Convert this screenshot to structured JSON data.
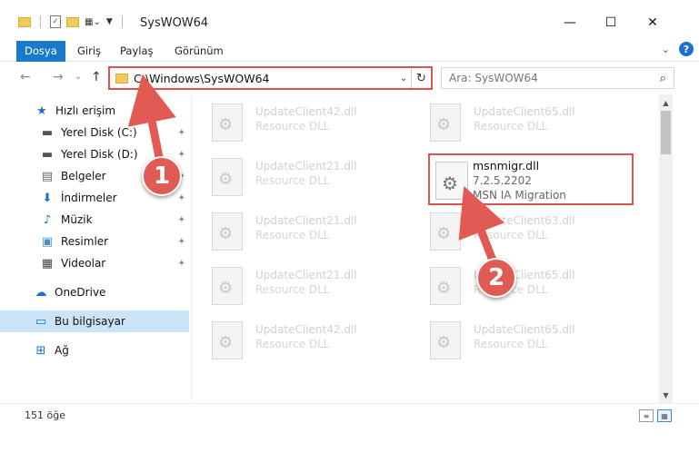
{
  "window": {
    "title": "SysWOW64",
    "minimize": "—",
    "maximize": "☐",
    "close": "✕"
  },
  "ribbon": {
    "tabs": [
      "Dosya",
      "Giriş",
      "Paylaş",
      "Görünüm"
    ],
    "expand": "⌄",
    "help": "?"
  },
  "nav": {
    "back": "←",
    "forward": "→",
    "recent": "⌄",
    "up": "↑"
  },
  "address": {
    "path": "C:\\Windows\\SysWOW64",
    "dropdown": "⌄",
    "refresh": "↻"
  },
  "search": {
    "placeholder": "Ara: SysWOW64",
    "icon": "⌕"
  },
  "sidebar": {
    "items": [
      {
        "label": "Hızlı erişim",
        "icon": "★"
      },
      {
        "label": "Yerel Disk (C:)",
        "icon": "▬",
        "pin": "✦"
      },
      {
        "label": "Yerel Disk (D:)",
        "icon": "▬",
        "pin": "✦"
      },
      {
        "label": "Belgeler",
        "icon": "▤",
        "pin": "✦"
      },
      {
        "label": "İndirmeler",
        "icon": "⬇",
        "pin": "✦"
      },
      {
        "label": "Müzik",
        "icon": "♪",
        "pin": "✦"
      },
      {
        "label": "Resimler",
        "icon": "▣",
        "pin": "✦"
      },
      {
        "label": "Videolar",
        "icon": "▦",
        "pin": "✦"
      },
      {
        "label": "OneDrive",
        "icon": "☁"
      },
      {
        "label": "Bu bilgisayar",
        "icon": "▭"
      },
      {
        "label": "Ağ",
        "icon": "⊞"
      }
    ]
  },
  "files": [
    {
      "name": "UpdateClient42.dll",
      "desc": "Resource DLL"
    },
    {
      "name": "UpdateClient65.dll",
      "desc": "Resource DLL"
    },
    {
      "name": "UpdateClient21.dll",
      "desc": "Resource DLL"
    },
    {
      "name": "UpdateClient21.dll",
      "desc": "Resource DLL"
    },
    {
      "name": "UpdateClient63.dll",
      "desc": "Resource DLL"
    },
    {
      "name": "UpdateClient21.dll",
      "desc": "Resource DLL"
    },
    {
      "name": "UpdateClient65.dll",
      "desc": "Resource DLL"
    },
    {
      "name": "UpdateClient42.dll",
      "desc": "Resource DLL"
    },
    {
      "name": "UpdateClient65.dll",
      "desc": "Resource DLL"
    }
  ],
  "highlighted_file": {
    "name": "msnmigr.dll",
    "version": "7.2.5.2202",
    "description": "MSN IA Migration"
  },
  "status": {
    "count": "151 öğe"
  },
  "annotations": {
    "step1": "1",
    "step2": "2",
    "accent": "#e25a54"
  },
  "colors": {
    "accent": "#1979ca",
    "selection": "#cce4f7",
    "highlight_border": "#d9534f"
  }
}
